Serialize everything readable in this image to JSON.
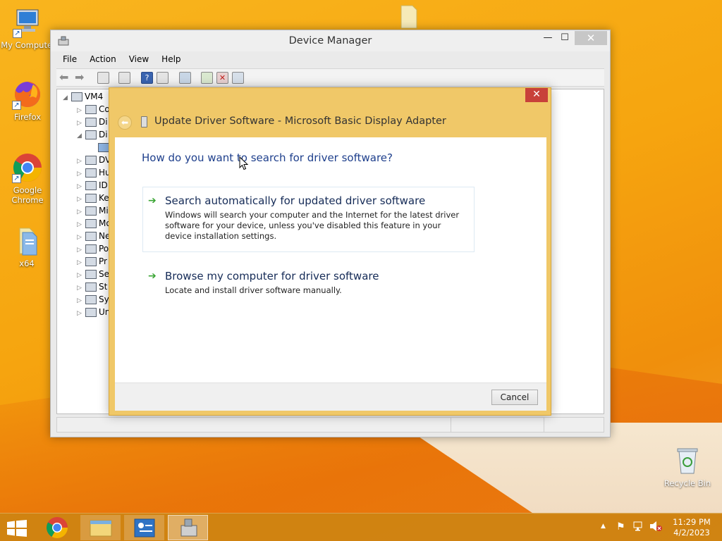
{
  "desktop": {
    "icons": [
      {
        "label": "My Computer",
        "icon": "computer-icon"
      },
      {
        "label": "Firefox",
        "icon": "firefox-icon"
      },
      {
        "label": "Google Chrome",
        "icon": "chrome-icon"
      },
      {
        "label": "x64",
        "icon": "folder-icon"
      },
      {
        "label": "Recycle Bin",
        "icon": "recycle-bin-icon"
      }
    ]
  },
  "device_manager": {
    "title": "Device Manager",
    "menu": [
      "File",
      "Action",
      "View",
      "Help"
    ],
    "tree": {
      "root": "VM4",
      "children": [
        "Co",
        "Di",
        "Di",
        "",
        "DV",
        "Hu",
        "ID",
        "Ke",
        "Mi",
        "Mo",
        "Ne",
        "Po",
        "Pr",
        "Se",
        "St",
        "Sy",
        "Un"
      ]
    }
  },
  "dialog": {
    "title": "Update Driver Software - Microsoft Basic Display Adapter",
    "question": "How do you want to search for driver software?",
    "options": [
      {
        "title": "Search automatically for updated driver software",
        "description": "Windows will search your computer and the Internet for the latest driver software for your device, unless you've disabled this feature in your device installation settings."
      },
      {
        "title": "Browse my computer for driver software",
        "description": "Locate and install driver software manually."
      }
    ],
    "cancel_label": "Cancel",
    "close_label": "✕"
  },
  "taskbar": {
    "time": "11:29 PM",
    "date": "4/2/2023"
  }
}
